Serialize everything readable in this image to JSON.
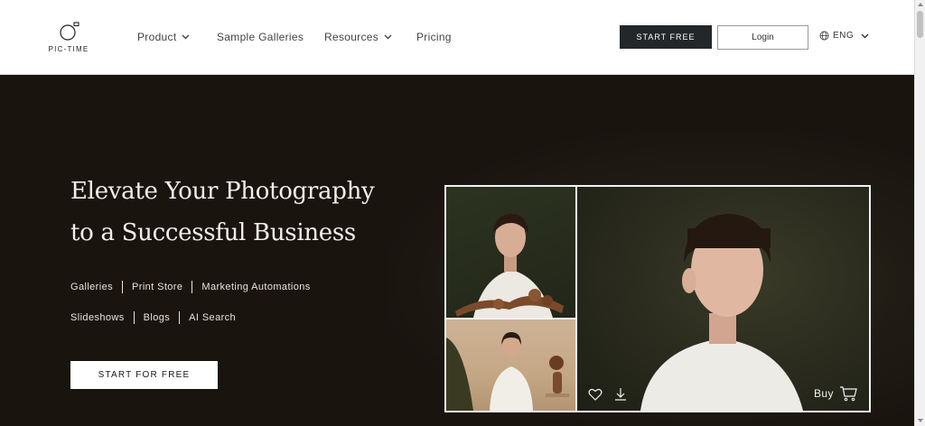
{
  "header": {
    "logo_text": "PIC-TIME",
    "nav": [
      {
        "label": "Product",
        "has_dropdown": true
      },
      {
        "label": "Sample Galleries",
        "has_dropdown": false
      },
      {
        "label": "Resources",
        "has_dropdown": true
      },
      {
        "label": "Pricing",
        "has_dropdown": false
      }
    ],
    "start_label": "START FREE",
    "login_label": "Login",
    "language": "ENG"
  },
  "hero": {
    "headline_line1": "Elevate Your Photography",
    "headline_line2": "to a Successful Business",
    "features_row1": [
      "Galleries",
      "Print Store",
      "Marketing Automations"
    ],
    "features_row2": [
      "Slideshows",
      "Blogs",
      "AI Search"
    ],
    "cta_label": "START FOR FREE"
  },
  "gallery": {
    "buy_label": "Buy",
    "icons": [
      "heart-icon",
      "download-icon",
      "cart-icon"
    ]
  },
  "colors": {
    "hero_background": "#1a140f",
    "header_background": "#ffffff",
    "start_button": "#24272a"
  }
}
